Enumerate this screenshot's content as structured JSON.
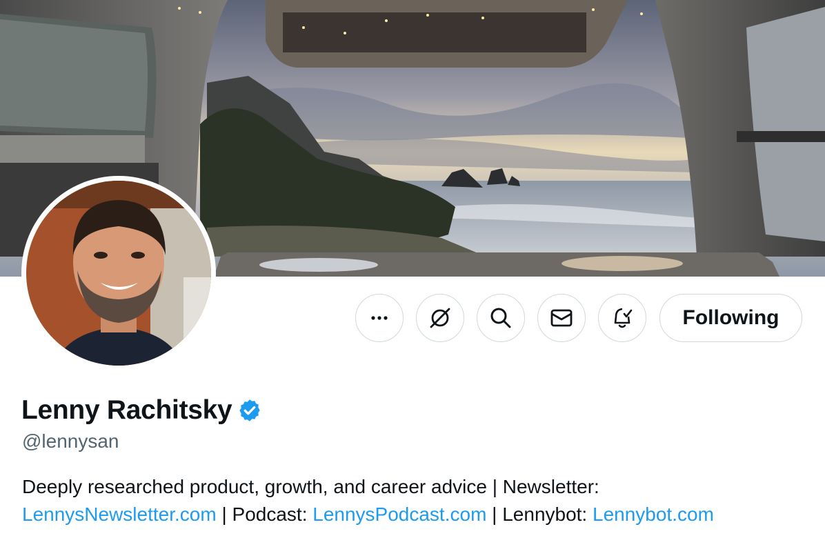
{
  "profile": {
    "name": "Lenny Rachitsky",
    "handle": "@lennysan",
    "verified": true
  },
  "actions": {
    "more_icon": "more-horizontal-icon",
    "grok_icon": "grok-icon",
    "search_icon": "search-icon",
    "message_icon": "envelope-icon",
    "notify_icon": "bell-check-icon",
    "follow_label": "Following"
  },
  "bio": {
    "line1": "Deeply researched product, growth, and career advice | Newsletter:",
    "link1": "LennysNewsletter.com",
    "sep1": " | Podcast: ",
    "link2": "LennysPodcast.com",
    "sep2": " | Lennybot: ",
    "link3": "Lennybot.com"
  },
  "colors": {
    "text": "#0f1419",
    "secondary": "#536471",
    "link": "#1d9bf0",
    "border": "#cfd9de",
    "verified": "#1d9bf0"
  }
}
